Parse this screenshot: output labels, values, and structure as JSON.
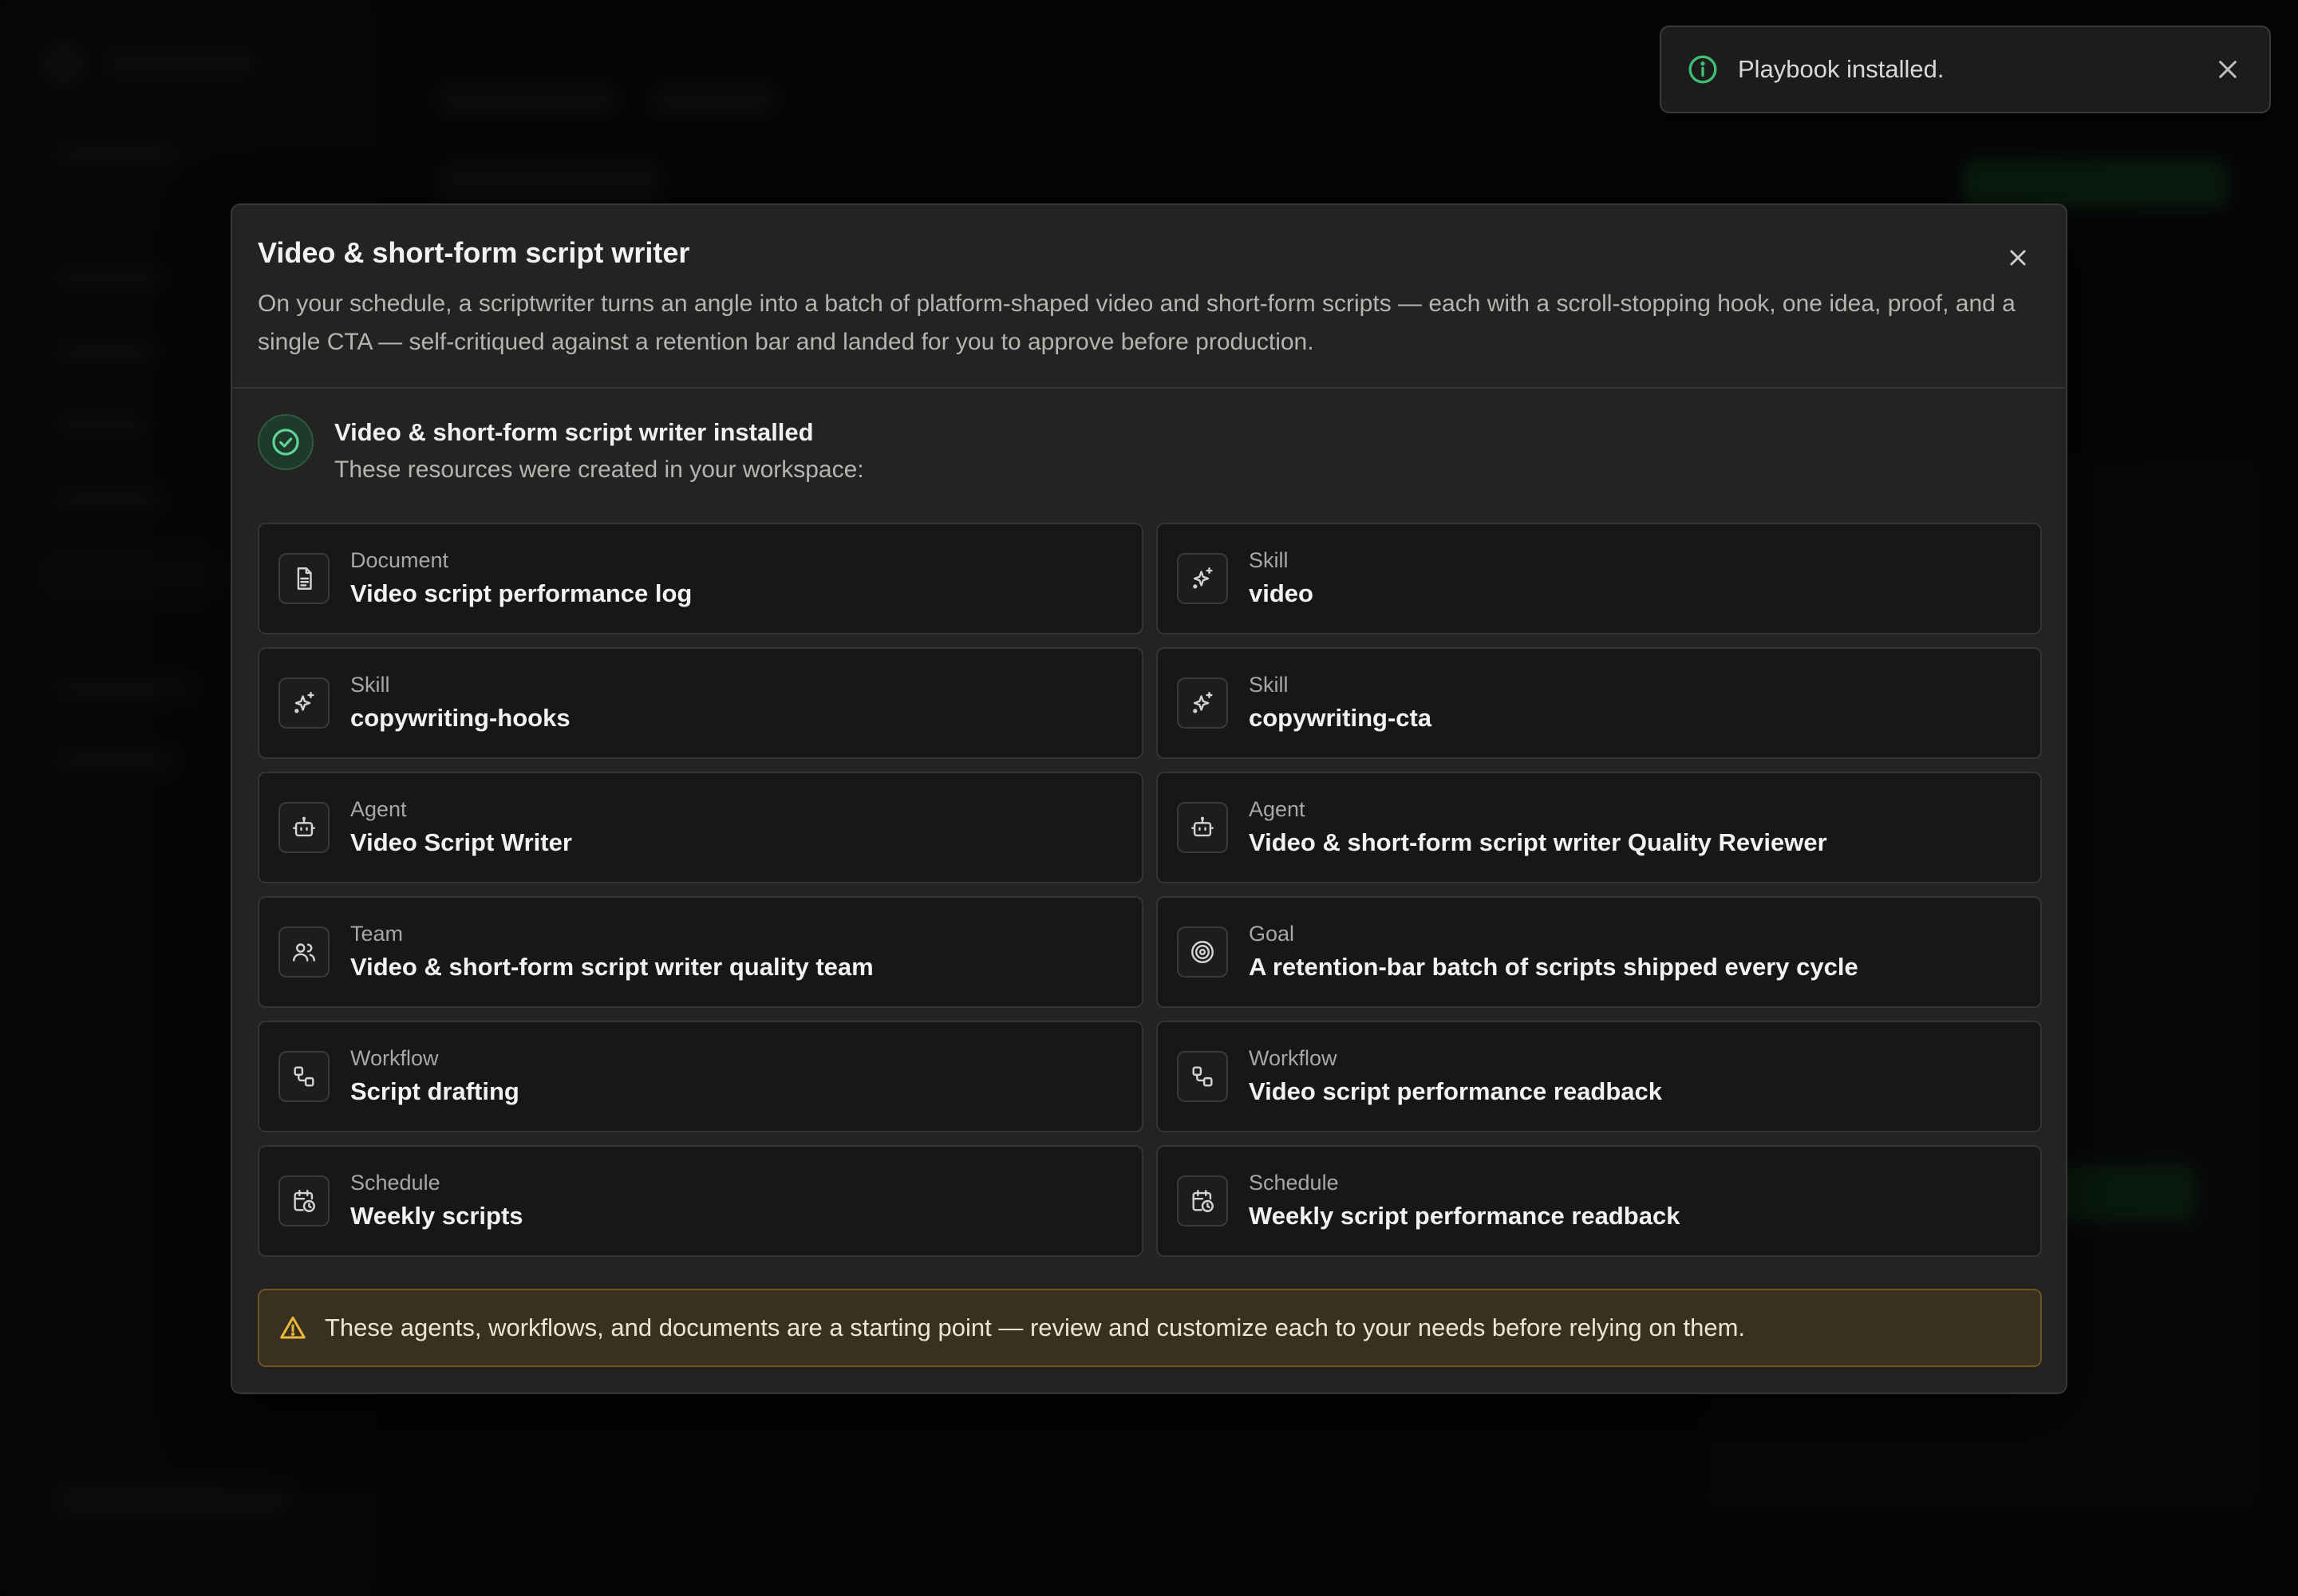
{
  "toast": {
    "message": "Playbook installed.",
    "icon": "info-icon",
    "accent": "#3fbf74"
  },
  "modal": {
    "title": "Video & short-form script writer",
    "description": "On your schedule, a scriptwriter turns an angle into a batch of platform-shaped video and short-form scripts — each with a scroll-stopping hook, one idea, proof, and a single CTA — self-critiqued against a retention bar and landed for you to approve before production.",
    "installed_title": "Video & short-form script writer installed",
    "installed_subtitle": "These resources were created in your workspace:",
    "resources": [
      {
        "type": "Document",
        "name": "Video script performance log",
        "icon": "document-icon"
      },
      {
        "type": "Skill",
        "name": "video",
        "icon": "sparkle-icon"
      },
      {
        "type": "Skill",
        "name": "copywriting-hooks",
        "icon": "sparkle-icon"
      },
      {
        "type": "Skill",
        "name": "copywriting-cta",
        "icon": "sparkle-icon"
      },
      {
        "type": "Agent",
        "name": "Video Script Writer",
        "icon": "robot-icon"
      },
      {
        "type": "Agent",
        "name": "Video & short-form script writer Quality Reviewer",
        "icon": "robot-icon"
      },
      {
        "type": "Team",
        "name": "Video & short-form script writer quality team",
        "icon": "users-icon"
      },
      {
        "type": "Goal",
        "name": "A retention-bar batch of scripts shipped every cycle",
        "icon": "target-icon"
      },
      {
        "type": "Workflow",
        "name": "Script drafting",
        "icon": "workflow-icon"
      },
      {
        "type": "Workflow",
        "name": "Video script performance readback",
        "icon": "workflow-icon"
      },
      {
        "type": "Schedule",
        "name": "Weekly scripts",
        "icon": "calendar-clock-icon"
      },
      {
        "type": "Schedule",
        "name": "Weekly script performance readback",
        "icon": "calendar-clock-icon"
      }
    ],
    "warning": "These agents, workflows, and documents are a starting point — review and customize each to your needs before relying on them."
  },
  "colors": {
    "success": "#3fbf74",
    "warning": "#e8b93a",
    "modal_bg": "#242322"
  }
}
